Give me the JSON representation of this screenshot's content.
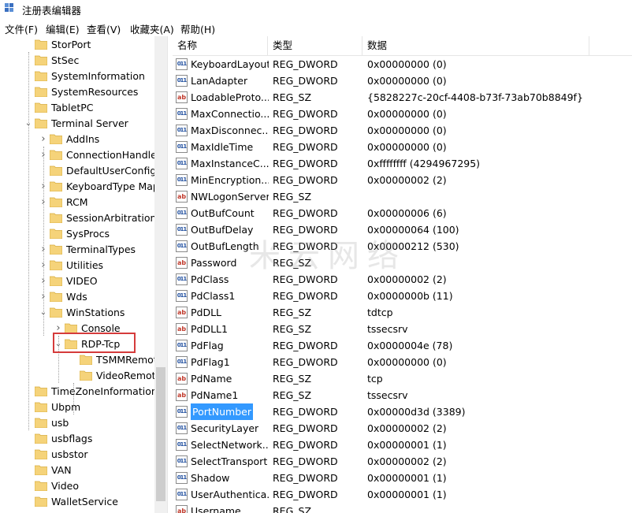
{
  "window": {
    "title": "注册表编辑器"
  },
  "menu": [
    "文件(F)",
    "编辑(E)",
    "查看(V)",
    "收藏夹(A)",
    "帮助(H)"
  ],
  "tree": [
    {
      "label": "StorPort",
      "depth": 0,
      "exp": ""
    },
    {
      "label": "StSec",
      "depth": 0,
      "exp": ""
    },
    {
      "label": "SystemInformation",
      "depth": 0,
      "exp": ""
    },
    {
      "label": "SystemResources",
      "depth": 0,
      "exp": ""
    },
    {
      "label": "TabletPC",
      "depth": 0,
      "exp": ""
    },
    {
      "label": "Terminal Server",
      "depth": 0,
      "exp": "open"
    },
    {
      "label": "AddIns",
      "depth": 1,
      "exp": "closed"
    },
    {
      "label": "ConnectionHandler",
      "depth": 1,
      "exp": "closed"
    },
    {
      "label": "DefaultUserConfigu",
      "depth": 1,
      "exp": ""
    },
    {
      "label": "KeyboardType Map",
      "depth": 1,
      "exp": "closed"
    },
    {
      "label": "RCM",
      "depth": 1,
      "exp": "closed"
    },
    {
      "label": "SessionArbitrationH",
      "depth": 1,
      "exp": ""
    },
    {
      "label": "SysProcs",
      "depth": 1,
      "exp": ""
    },
    {
      "label": "TerminalTypes",
      "depth": 1,
      "exp": "closed"
    },
    {
      "label": "Utilities",
      "depth": 1,
      "exp": "closed"
    },
    {
      "label": "VIDEO",
      "depth": 1,
      "exp": "closed"
    },
    {
      "label": "Wds",
      "depth": 1,
      "exp": "closed"
    },
    {
      "label": "WinStations",
      "depth": 1,
      "exp": "open"
    },
    {
      "label": "Console",
      "depth": 2,
      "exp": "closed"
    },
    {
      "label": "RDP-Tcp",
      "depth": 2,
      "exp": "open"
    },
    {
      "label": "TSMMRemot",
      "depth": 3,
      "exp": ""
    },
    {
      "label": "VideoRemoti",
      "depth": 3,
      "exp": ""
    },
    {
      "label": "TimeZoneInformation",
      "depth": 0,
      "exp": ""
    },
    {
      "label": "Ubpm",
      "depth": 0,
      "exp": ""
    },
    {
      "label": "usb",
      "depth": 0,
      "exp": ""
    },
    {
      "label": "usbflags",
      "depth": 0,
      "exp": ""
    },
    {
      "label": "usbstor",
      "depth": 0,
      "exp": ""
    },
    {
      "label": "VAN",
      "depth": 0,
      "exp": ""
    },
    {
      "label": "Video",
      "depth": 0,
      "exp": ""
    },
    {
      "label": "WalletService",
      "depth": 0,
      "exp": ""
    }
  ],
  "list": {
    "columns": [
      "名称",
      "类型",
      "数据"
    ],
    "rows": [
      {
        "name": "KeyboardLayout",
        "type": "REG_DWORD",
        "data": "0x00000000 (0)",
        "kind": "dw"
      },
      {
        "name": "LanAdapter",
        "type": "REG_DWORD",
        "data": "0x00000000 (0)",
        "kind": "dw"
      },
      {
        "name": "LoadableProto...",
        "type": "REG_SZ",
        "data": "{5828227c-20cf-4408-b73f-73ab70b8849f}",
        "kind": "sz"
      },
      {
        "name": "MaxConnectio...",
        "type": "REG_DWORD",
        "data": "0x00000000 (0)",
        "kind": "dw"
      },
      {
        "name": "MaxDisconnec...",
        "type": "REG_DWORD",
        "data": "0x00000000 (0)",
        "kind": "dw"
      },
      {
        "name": "MaxIdleTime",
        "type": "REG_DWORD",
        "data": "0x00000000 (0)",
        "kind": "dw"
      },
      {
        "name": "MaxInstanceC...",
        "type": "REG_DWORD",
        "data": "0xffffffff (4294967295)",
        "kind": "dw"
      },
      {
        "name": "MinEncryption...",
        "type": "REG_DWORD",
        "data": "0x00000002 (2)",
        "kind": "dw"
      },
      {
        "name": "NWLogonServer",
        "type": "REG_SZ",
        "data": "",
        "kind": "sz"
      },
      {
        "name": "OutBufCount",
        "type": "REG_DWORD",
        "data": "0x00000006 (6)",
        "kind": "dw"
      },
      {
        "name": "OutBufDelay",
        "type": "REG_DWORD",
        "data": "0x00000064 (100)",
        "kind": "dw"
      },
      {
        "name": "OutBufLength",
        "type": "REG_DWORD",
        "data": "0x00000212 (530)",
        "kind": "dw"
      },
      {
        "name": "Password",
        "type": "REG_SZ",
        "data": "",
        "kind": "sz"
      },
      {
        "name": "PdClass",
        "type": "REG_DWORD",
        "data": "0x00000002 (2)",
        "kind": "dw"
      },
      {
        "name": "PdClass1",
        "type": "REG_DWORD",
        "data": "0x0000000b (11)",
        "kind": "dw"
      },
      {
        "name": "PdDLL",
        "type": "REG_SZ",
        "data": "tdtcp",
        "kind": "sz"
      },
      {
        "name": "PdDLL1",
        "type": "REG_SZ",
        "data": "tssecsrv",
        "kind": "sz"
      },
      {
        "name": "PdFlag",
        "type": "REG_DWORD",
        "data": "0x0000004e (78)",
        "kind": "dw"
      },
      {
        "name": "PdFlag1",
        "type": "REG_DWORD",
        "data": "0x00000000 (0)",
        "kind": "dw"
      },
      {
        "name": "PdName",
        "type": "REG_SZ",
        "data": "tcp",
        "kind": "sz"
      },
      {
        "name": "PdName1",
        "type": "REG_SZ",
        "data": "tssecsrv",
        "kind": "sz"
      },
      {
        "name": "PortNumber",
        "type": "REG_DWORD",
        "data": "0x00000d3d (3389)",
        "kind": "dw",
        "selected": true
      },
      {
        "name": "SecurityLayer",
        "type": "REG_DWORD",
        "data": "0x00000002 (2)",
        "kind": "dw"
      },
      {
        "name": "SelectNetwork...",
        "type": "REG_DWORD",
        "data": "0x00000001 (1)",
        "kind": "dw"
      },
      {
        "name": "SelectTransport",
        "type": "REG_DWORD",
        "data": "0x00000002 (2)",
        "kind": "dw"
      },
      {
        "name": "Shadow",
        "type": "REG_DWORD",
        "data": "0x00000001 (1)",
        "kind": "dw"
      },
      {
        "name": "UserAuthentica...",
        "type": "REG_DWORD",
        "data": "0x00000001 (1)",
        "kind": "dw"
      },
      {
        "name": "Username",
        "type": "REG_SZ",
        "data": "",
        "kind": "sz"
      }
    ]
  },
  "watermark": "米云网络",
  "colors": {
    "selection": "#3399ff",
    "highlight_box": "#d53b3b",
    "folder": "#f5d37a"
  }
}
